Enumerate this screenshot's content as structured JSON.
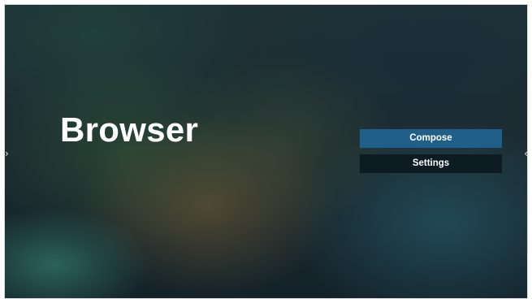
{
  "app": {
    "title": "Browser"
  },
  "menu": {
    "items": [
      {
        "label": "Compose",
        "state": "focused"
      },
      {
        "label": "Settings",
        "state": "normal"
      }
    ]
  },
  "nav": {
    "left_arrow_icon": "chevron-right-icon",
    "right_arrow_icon": "chevron-left-icon",
    "left_glyph": "›",
    "right_glyph": "‹"
  },
  "colors": {
    "focused_button": "#1f5f8a",
    "normal_button": "#0d1b22",
    "text": "#ffffff"
  }
}
